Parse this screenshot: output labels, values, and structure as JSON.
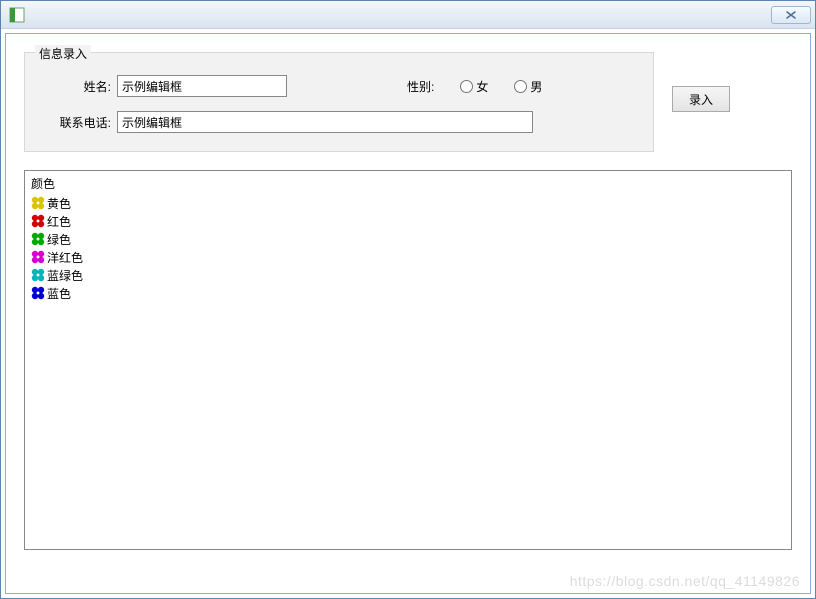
{
  "window": {
    "title": ""
  },
  "form": {
    "legend": "信息录入",
    "name_label": "姓名:",
    "name_value": "示例编辑框",
    "gender_label": "性别:",
    "gender_female": "女",
    "gender_male": "男",
    "phone_label": "联系电话:",
    "phone_value": "示例编辑框",
    "submit_label": "录入"
  },
  "tree": {
    "root_label": "颜色",
    "items": [
      {
        "label": "黄色",
        "color": "#d9c500"
      },
      {
        "label": "红色",
        "color": "#d40000"
      },
      {
        "label": "绿色",
        "color": "#00a900"
      },
      {
        "label": "洋红色",
        "color": "#d400d4"
      },
      {
        "label": "蓝绿色",
        "color": "#00b5b5"
      },
      {
        "label": "蓝色",
        "color": "#0000d8"
      }
    ]
  },
  "watermark": "https://blog.csdn.net/qq_41149826"
}
